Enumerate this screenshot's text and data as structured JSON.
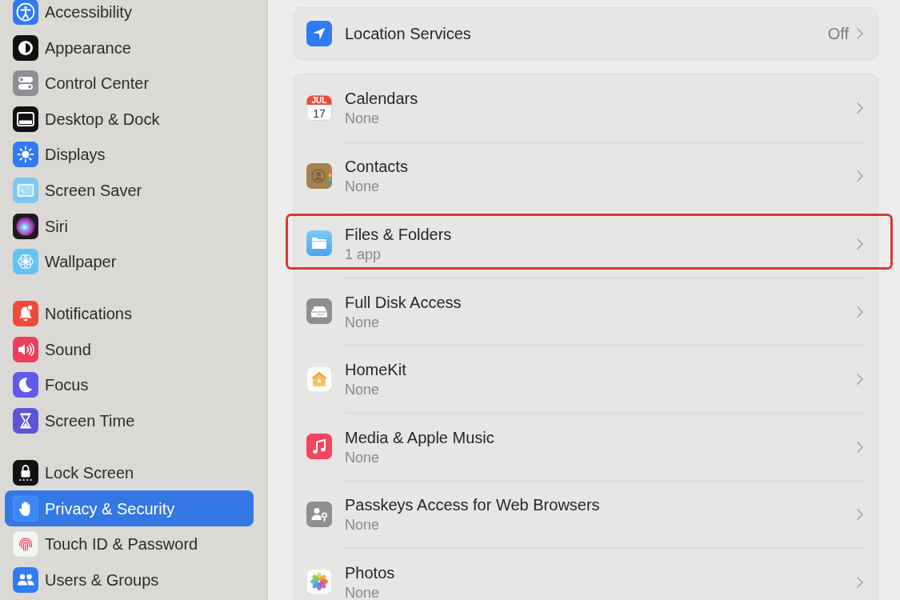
{
  "sidebar": {
    "groups": [
      {
        "items": [
          {
            "label": "Accessibility",
            "selected": false
          },
          {
            "label": "Appearance",
            "selected": false
          },
          {
            "label": "Control Center",
            "selected": false
          },
          {
            "label": "Desktop & Dock",
            "selected": false
          },
          {
            "label": "Displays",
            "selected": false
          },
          {
            "label": "Screen Saver",
            "selected": false
          },
          {
            "label": "Siri",
            "selected": false
          },
          {
            "label": "Wallpaper",
            "selected": false
          }
        ]
      },
      {
        "items": [
          {
            "label": "Notifications",
            "selected": false
          },
          {
            "label": "Sound",
            "selected": false
          },
          {
            "label": "Focus",
            "selected": false
          },
          {
            "label": "Screen Time",
            "selected": false
          }
        ]
      },
      {
        "items": [
          {
            "label": "Lock Screen",
            "selected": false
          },
          {
            "label": "Privacy & Security",
            "selected": true
          },
          {
            "label": "Touch ID & Password",
            "selected": false
          },
          {
            "label": "Users & Groups",
            "selected": false
          }
        ]
      }
    ]
  },
  "location_services": {
    "title": "Location Services",
    "value": "Off"
  },
  "privacy_items": [
    {
      "title": "Calendars",
      "subtitle": "None",
      "highlighted": false,
      "icon_month": "JUL",
      "icon_day": "17"
    },
    {
      "title": "Contacts",
      "subtitle": "None",
      "highlighted": false
    },
    {
      "title": "Files & Folders",
      "subtitle": "1 app",
      "highlighted": true
    },
    {
      "title": "Full Disk Access",
      "subtitle": "None",
      "highlighted": false
    },
    {
      "title": "HomeKit",
      "subtitle": "None",
      "highlighted": false
    },
    {
      "title": "Media & Apple Music",
      "subtitle": "None",
      "highlighted": false
    },
    {
      "title": "Passkeys Access for Web Browsers",
      "subtitle": "None",
      "highlighted": false
    },
    {
      "title": "Photos",
      "subtitle": "None",
      "highlighted": false
    }
  ]
}
